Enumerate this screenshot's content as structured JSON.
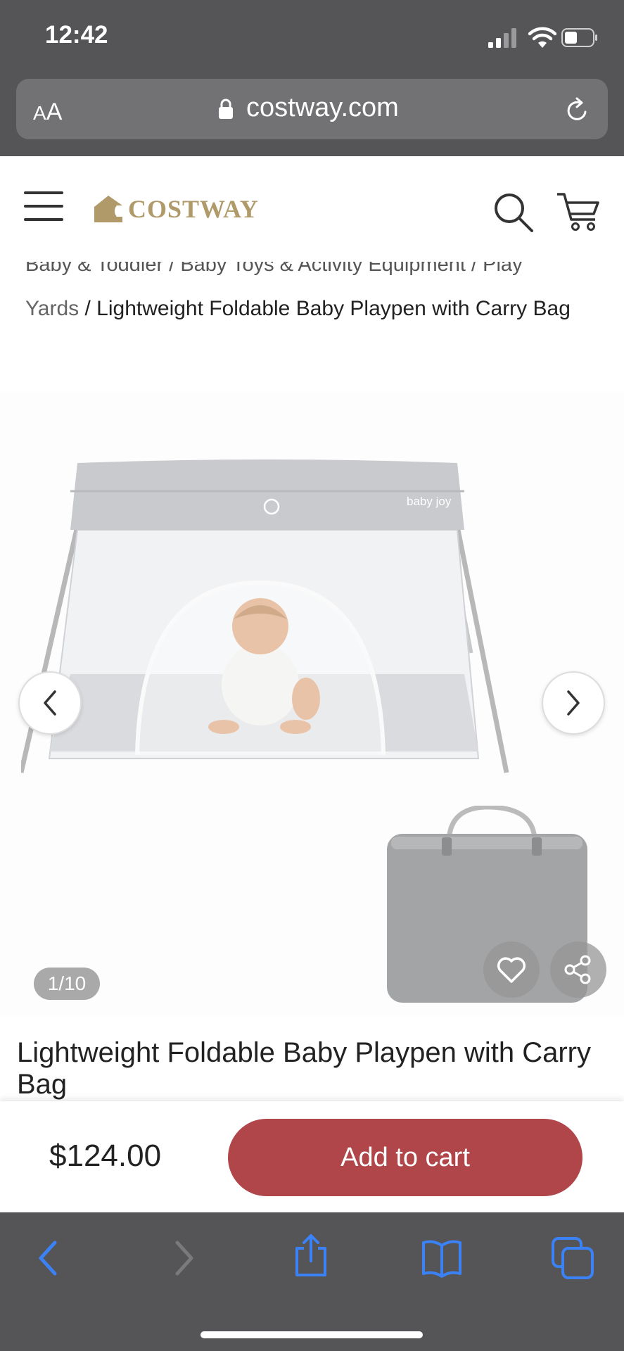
{
  "status_bar": {
    "time": "12:42"
  },
  "browser": {
    "text_size_label_small": "A",
    "text_size_label_large": "A",
    "url": "costway.com"
  },
  "header": {
    "logo_text": "COSTWAY"
  },
  "breadcrumb": {
    "cut_line": "Baby & Toddler / Baby Toys & Activity Equipment / Play",
    "link": "Yards",
    "separator": " / ",
    "current": "Lightweight Foldable Baby Playpen with Carry Bag"
  },
  "gallery": {
    "counter": "1/10",
    "brand_mark": "baby joy"
  },
  "product": {
    "title": "Lightweight Foldable Baby Playpen with Carry Bag"
  },
  "purchase_bar": {
    "price": "$124.00",
    "add_to_cart_label": "Add to cart"
  },
  "colors": {
    "accent": "#b1464a",
    "logo_gold": "#b19a6a",
    "toolbar_blue": "#3b82f6",
    "browser_chrome": "#555557"
  }
}
